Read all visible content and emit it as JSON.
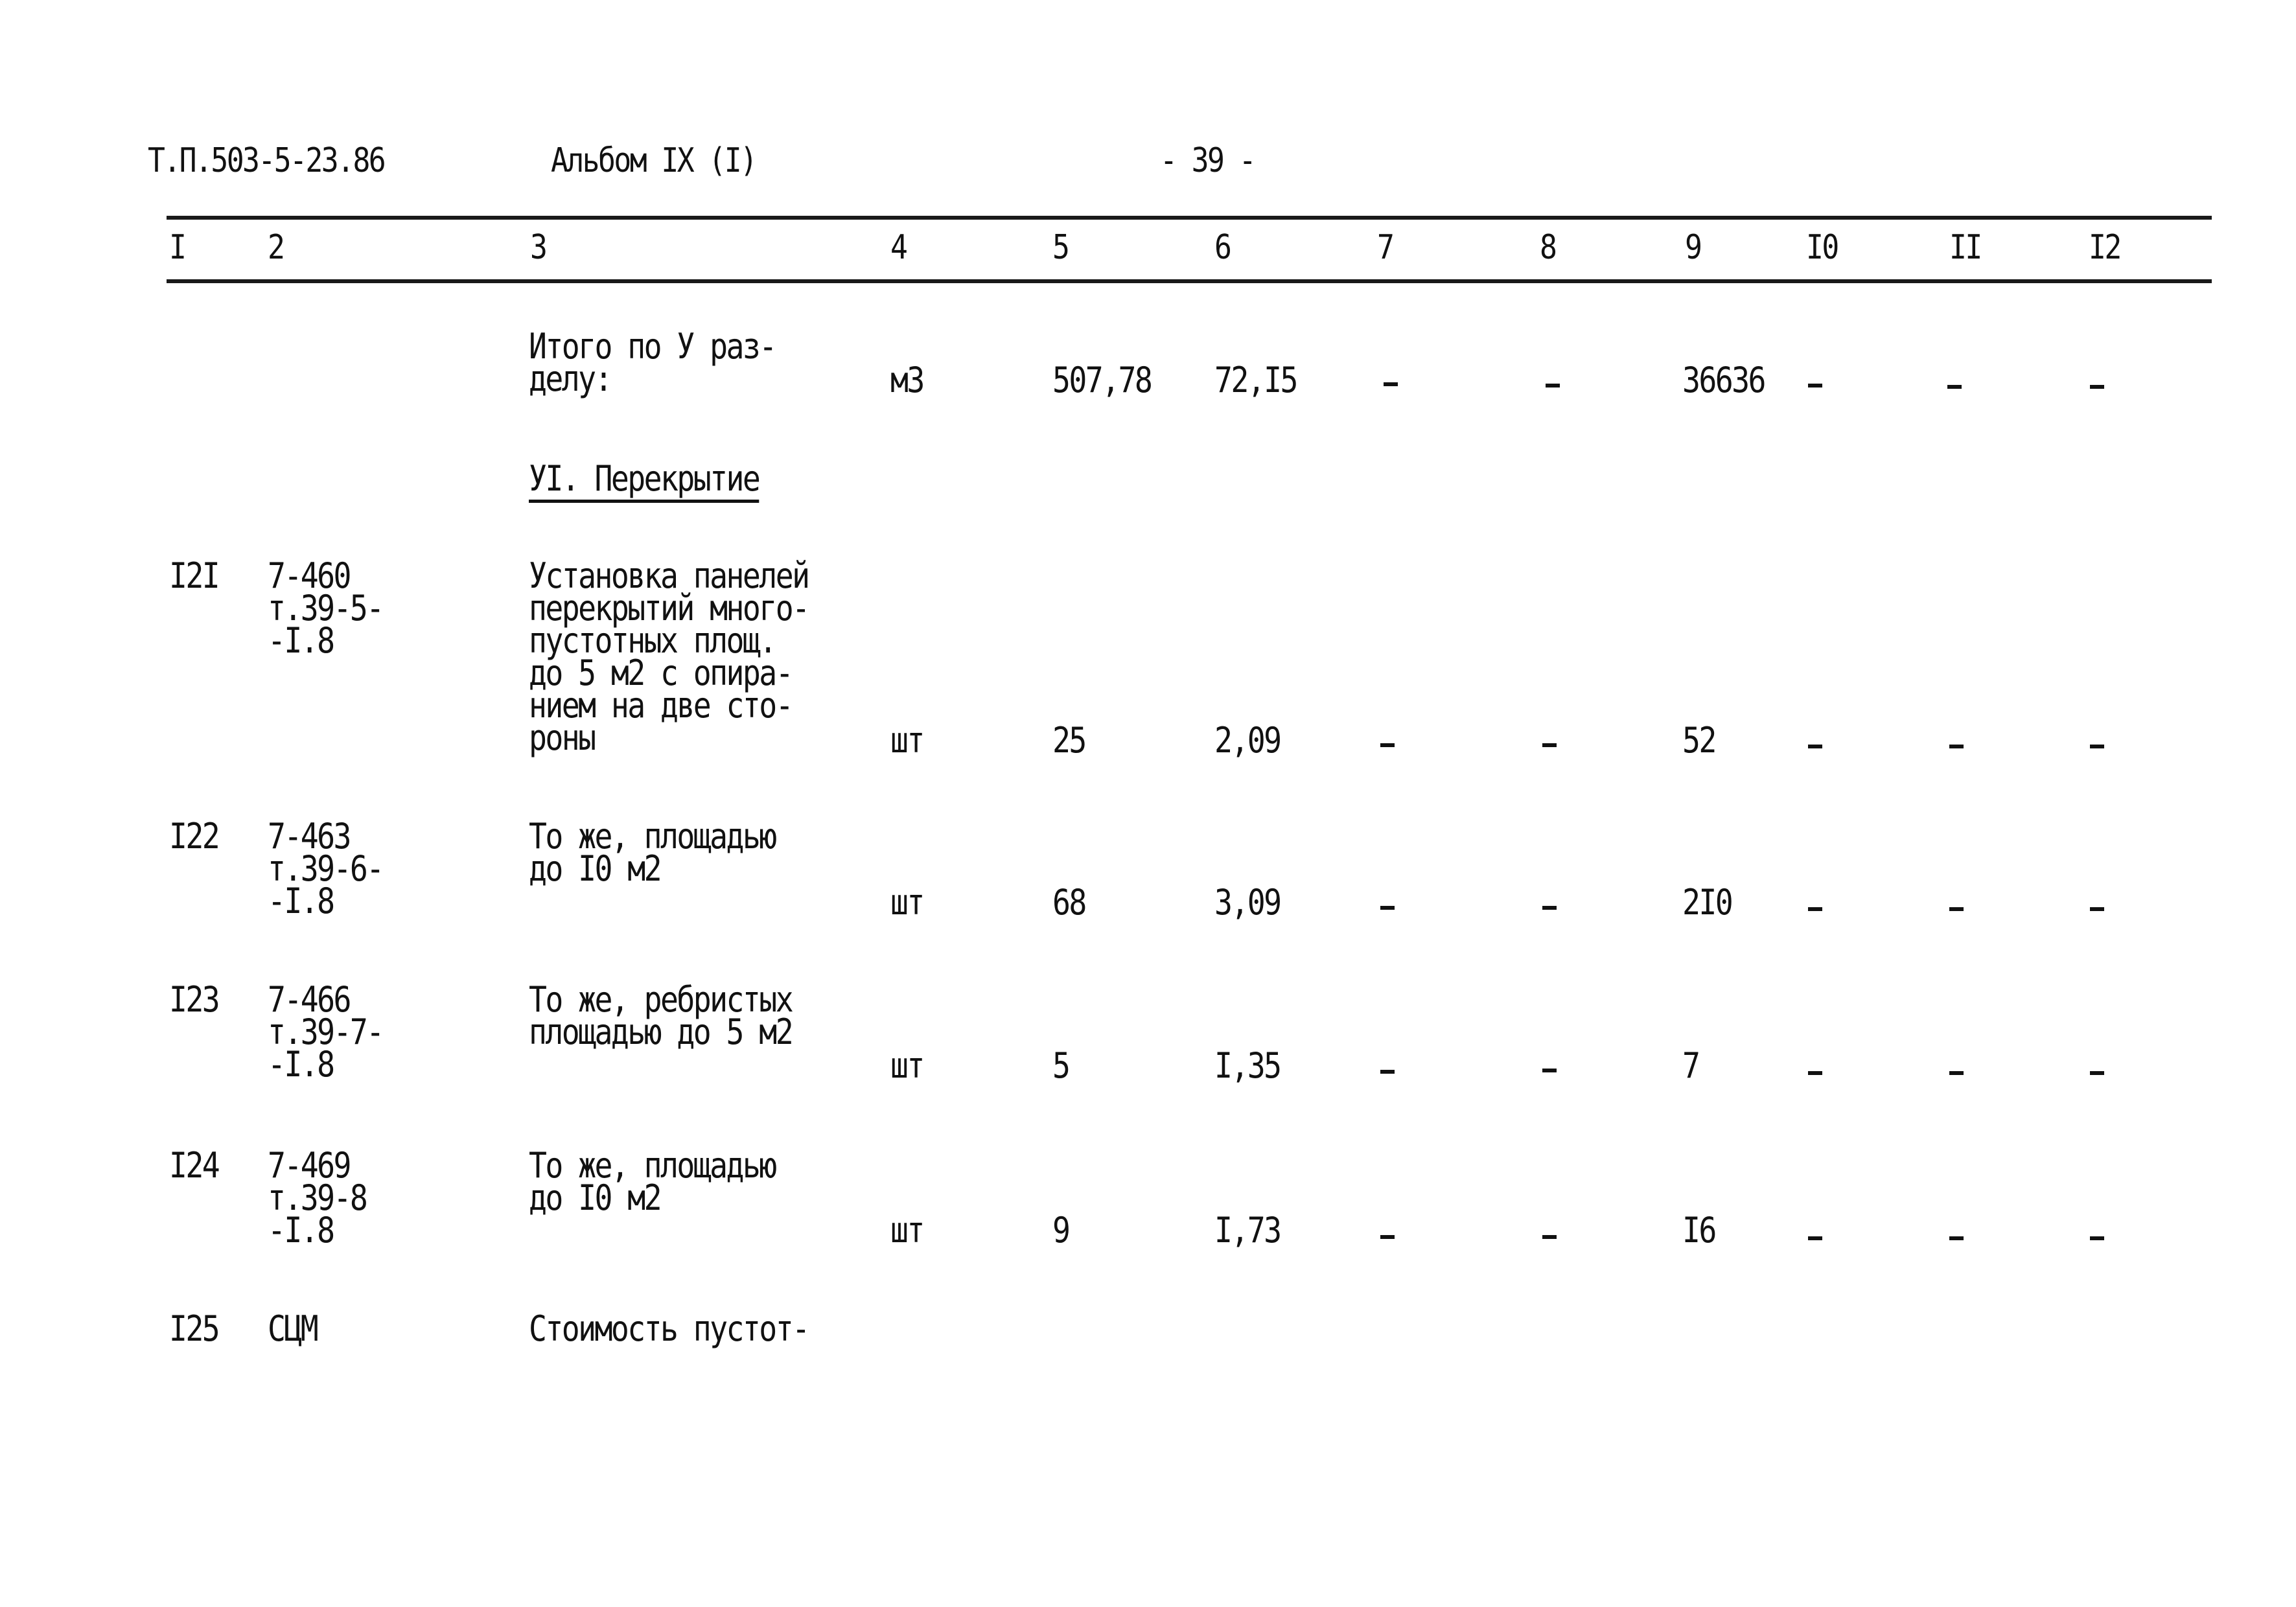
{
  "header": {
    "doc_code": "Т.П.503-5-23.86",
    "album": "Альбом IX (I)",
    "page": "- 39 -"
  },
  "columns": [
    "I",
    "2",
    "3",
    "4",
    "5",
    "6",
    "7",
    "8",
    "9",
    "I0",
    "II",
    "I2"
  ],
  "subtotal": {
    "label": "Итого по У раз-\nделу:",
    "unit": "м3",
    "c5": "507,78",
    "c6": "72,I5",
    "c7": "-",
    "c8": "-",
    "c9": "36636",
    "c10": "-",
    "c11": "-",
    "c12": "-"
  },
  "section": {
    "title": "УI. Перекрытие"
  },
  "rows": [
    {
      "num": "I2I",
      "code": "7-460\nт.39-5-\n-I.8",
      "desc": "Установка панелей\nперекрытий много-\nпустотных площ.\nдо 5 м2 с опира-\nнием на две сто-\nроны",
      "unit": "шт",
      "c5": "25",
      "c6": "2,09",
      "c7": "-",
      "c8": "-",
      "c9": "52",
      "c10": "-",
      "c11": "-",
      "c12": "-"
    },
    {
      "num": "I22",
      "code": "7-463\nт.39-6-\n-I.8",
      "desc": "То же, площадью\nдо I0 м2",
      "unit": "шт",
      "c5": "68",
      "c6": "3,09",
      "c7": "-",
      "c8": "-",
      "c9": "2I0",
      "c10": "-",
      "c11": "-",
      "c12": "-"
    },
    {
      "num": "I23",
      "code": "7-466\nт.39-7-\n-I.8",
      "desc": "То же, ребристых\nплощадью до 5 м2",
      "unit": "шт",
      "c5": "5",
      "c6": "I,35",
      "c7": "-",
      "c8": "-",
      "c9": "7",
      "c10": "-",
      "c11": "-",
      "c12": "-"
    },
    {
      "num": "I24",
      "code": "7-469\nт.39-8\n-I.8",
      "desc": "То же, площадью\nдо I0 м2",
      "unit": "шт",
      "c5": "9",
      "c6": "I,73",
      "c7": "-",
      "c8": "-",
      "c9": "I6",
      "c10": "-",
      "c11": "-",
      "c12": "-"
    },
    {
      "num": "I25",
      "code": "СЦМ",
      "desc": "Стоимость пустот-"
    }
  ]
}
